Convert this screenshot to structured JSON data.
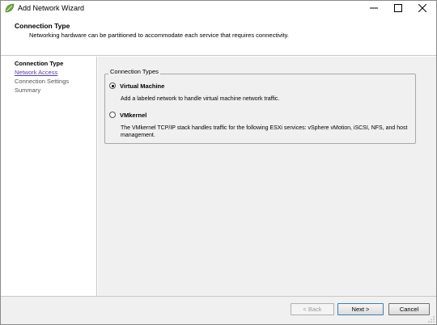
{
  "window": {
    "title": "Add Network Wizard",
    "app_icon": "vmware-leaf-icon",
    "controls": {
      "minimize": "—",
      "maximize": "☐",
      "close": "✕"
    }
  },
  "header": {
    "title": "Connection Type",
    "subtitle": "Networking hardware can be partitioned to accommodate each service that requires connectivity."
  },
  "nav": {
    "items": [
      {
        "label": "Connection Type",
        "state": "active"
      },
      {
        "label": "Network Access",
        "state": "link"
      },
      {
        "label": "Connection Settings",
        "state": "inactive"
      },
      {
        "label": "Summary",
        "state": "inactive"
      }
    ]
  },
  "connection_types": {
    "legend": "Connection Types",
    "options": [
      {
        "label": "Virtual Machine",
        "description": "Add a labeled network to handle virtual machine network traffic.",
        "checked": true
      },
      {
        "label": "VMkernel",
        "description": "The VMkernel TCP/IP stack handles traffic for the following ESXi services: vSphere vMotion, iSCSI, NFS, and host management.",
        "checked": false
      }
    ]
  },
  "buttons": {
    "back": "< Back",
    "next": "Next >",
    "cancel": "Cancel"
  },
  "colors": {
    "content_bg": "#f0f0f0",
    "link": "#5a3ea8",
    "icon_green": "#6ba539"
  }
}
